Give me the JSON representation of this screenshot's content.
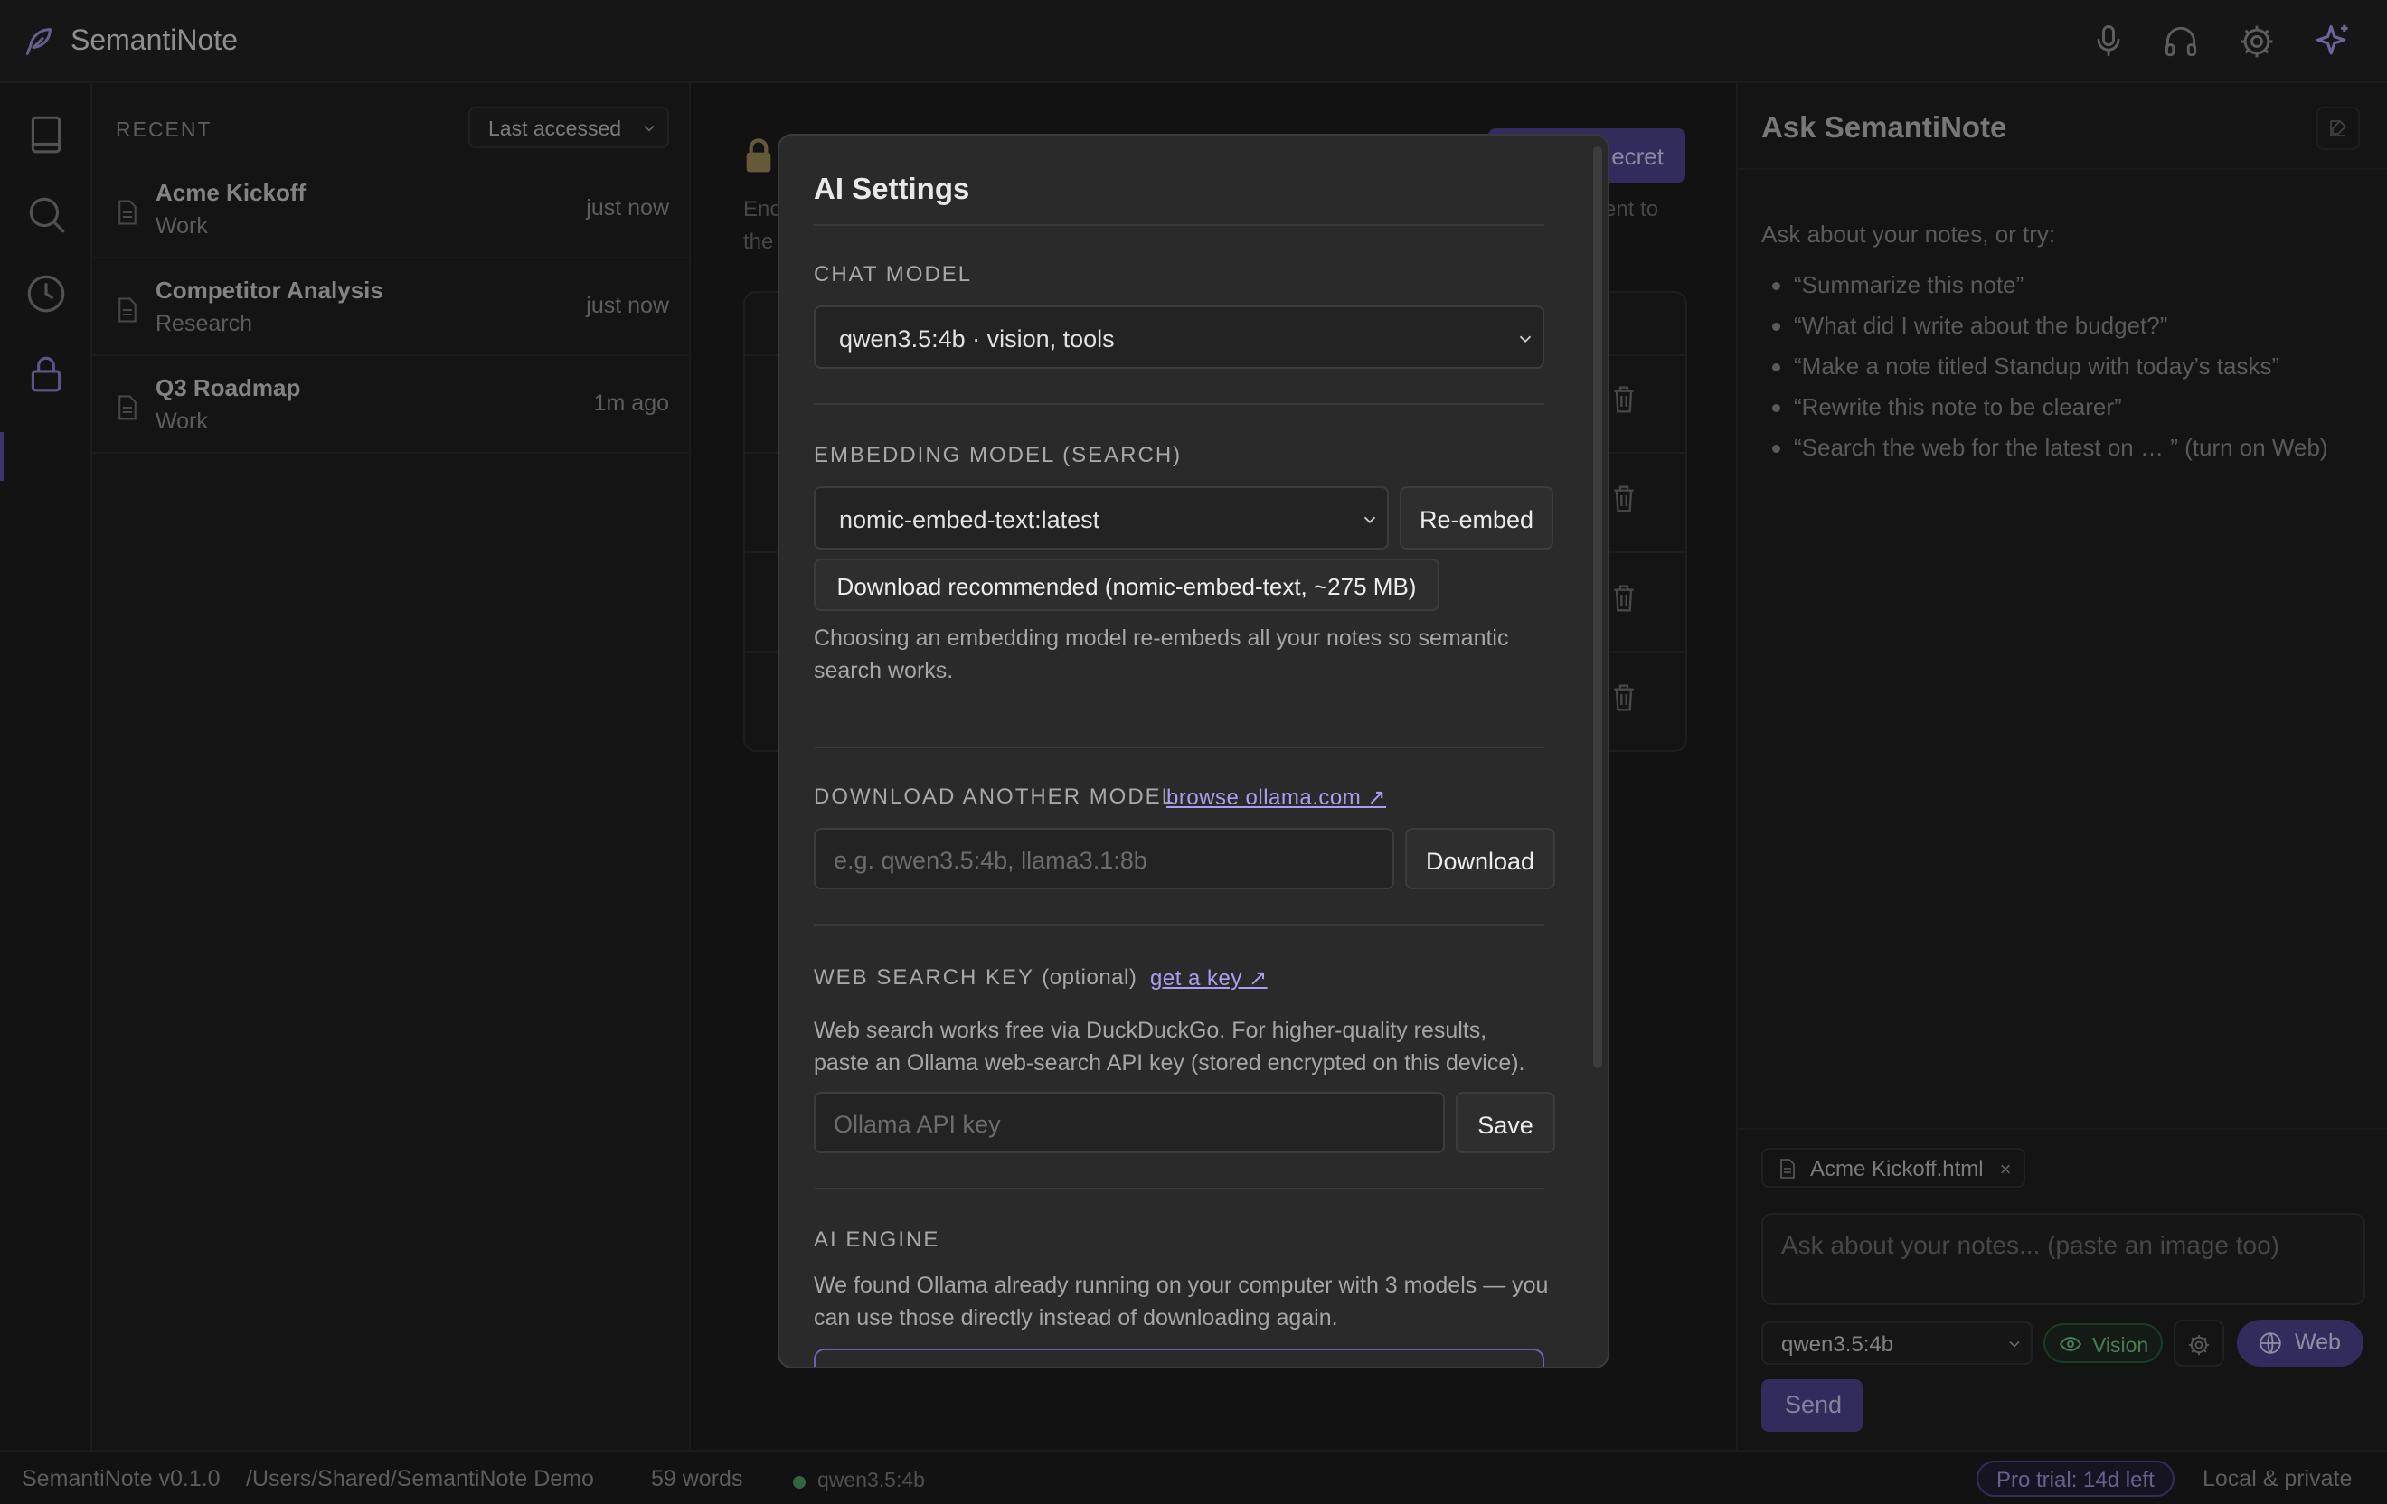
{
  "app": {
    "title": "SemantiNote"
  },
  "topbar": {
    "icons": [
      "microphone-icon",
      "headphones-icon",
      "gear-icon",
      "sparkle-icon"
    ]
  },
  "rail": {
    "icons": [
      "notebook-icon",
      "search-icon",
      "clock-icon",
      "lock-icon"
    ],
    "active": "lock-icon"
  },
  "notelist": {
    "section_label": "RECENT",
    "sort": "Last accessed",
    "notes": [
      {
        "title": "Acme Kickoff",
        "folder": "Work",
        "time": "just now"
      },
      {
        "title": "Competitor Analysis",
        "folder": "Research",
        "time": "just now"
      },
      {
        "title": "Q3 Roadmap",
        "folder": "Work",
        "time": "1m ago"
      }
    ]
  },
  "center_background": {
    "button_partial": "ecret",
    "text_left_1": "Enc",
    "text_left_2": "the",
    "text_right": "ent to"
  },
  "modal": {
    "title": "AI Settings",
    "chat_model": {
      "label": "CHAT MODEL",
      "value": "qwen3.5:4b · vision, tools"
    },
    "embedding": {
      "label": "EMBEDDING MODEL",
      "label_suffix": "(SEARCH)",
      "value": "nomic-embed-text:latest",
      "reembed_label": "Re-embed",
      "download_recommended_label": "Download recommended (nomic-embed-text, ~275 MB)",
      "help_line1": "Choosing an embedding model re-embeds all your notes so semantic",
      "help_line2": "search works."
    },
    "download_model": {
      "label": "DOWNLOAD ANOTHER MODEL",
      "link": "browse ollama.com ↗",
      "placeholder": "e.g. qwen3.5:4b, llama3.1:8b",
      "button": "Download"
    },
    "web_search": {
      "label": "WEB SEARCH KEY",
      "label_suffix": "(optional)",
      "link": "get a key ↗",
      "help_line1": "Web search works free via DuckDuckGo. For higher-quality results,",
      "help_line2": "paste an Ollama web-search API key (stored encrypted on this device).",
      "placeholder": "Ollama API key",
      "button": "Save"
    },
    "ai_engine": {
      "label": "AI ENGINE",
      "help_line1": "We found Ollama already running on your computer with 3 models — you",
      "help_line2": "can use those directly instead of downloading again."
    }
  },
  "rightpanel": {
    "title": "Ask SemantiNote",
    "intro": "Ask about your notes, or try:",
    "suggestions": [
      "“Summarize this note”",
      "“What did I write about the budget?”",
      "“Make a note titled Standup with today’s tasks”",
      "“Rewrite this note to be clearer”",
      "“Search the web for the latest on … ” (turn on Web)"
    ],
    "attachment": "Acme Kickoff.html",
    "attachment_remove": "×",
    "input_placeholder": "Ask about your notes... (paste an image too)",
    "model": "qwen3.5:4b",
    "vision_label": "Vision",
    "web_label": "Web",
    "send_label": "Send"
  },
  "statusbar": {
    "version": "SemantiNote v0.1.0",
    "path": "/Users/Shared/SemantiNote Demo",
    "words": "59 words",
    "model": "qwen3.5:4b",
    "trial": "Pro trial: 14d left",
    "privacy": "Local & private"
  },
  "colors": {
    "accent": "#4d4490",
    "link": "#a99ef0",
    "status_ok": "#4f9a63",
    "vision_green": "#6fbf82"
  }
}
